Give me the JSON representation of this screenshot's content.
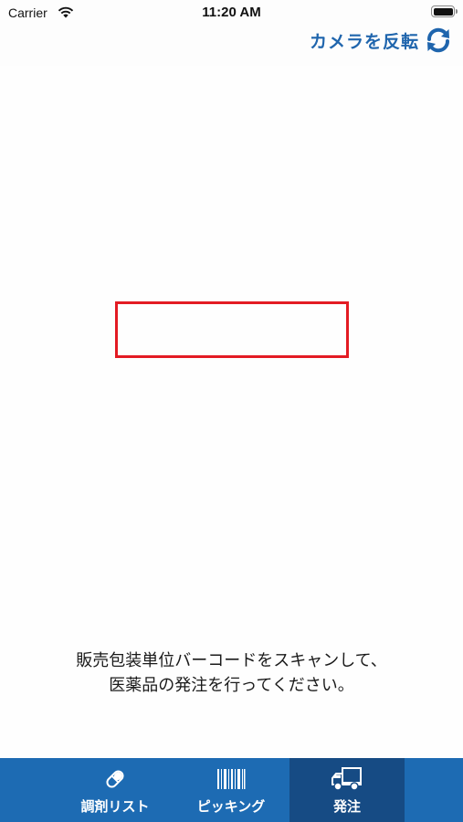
{
  "status_bar": {
    "carrier": "Carrier",
    "time": "11:20 AM"
  },
  "header": {
    "flip_camera_label": "カメラを反転",
    "flip_camera_icon": "refresh-icon"
  },
  "scanner": {
    "instruction_line1": "販売包装単位バーコードをスキャンして、",
    "instruction_line2": "医薬品の発注を行ってください。",
    "frame_color": "#e31b23"
  },
  "tab_bar": {
    "background": "#1d6bb3",
    "active_background": "#164b84",
    "tabs": [
      {
        "label": "調剤リスト",
        "icon": "pill-icon",
        "active": false
      },
      {
        "label": "ピッキング",
        "icon": "barcode-icon",
        "active": false
      },
      {
        "label": "発注",
        "icon": "truck-icon",
        "active": true
      }
    ]
  }
}
